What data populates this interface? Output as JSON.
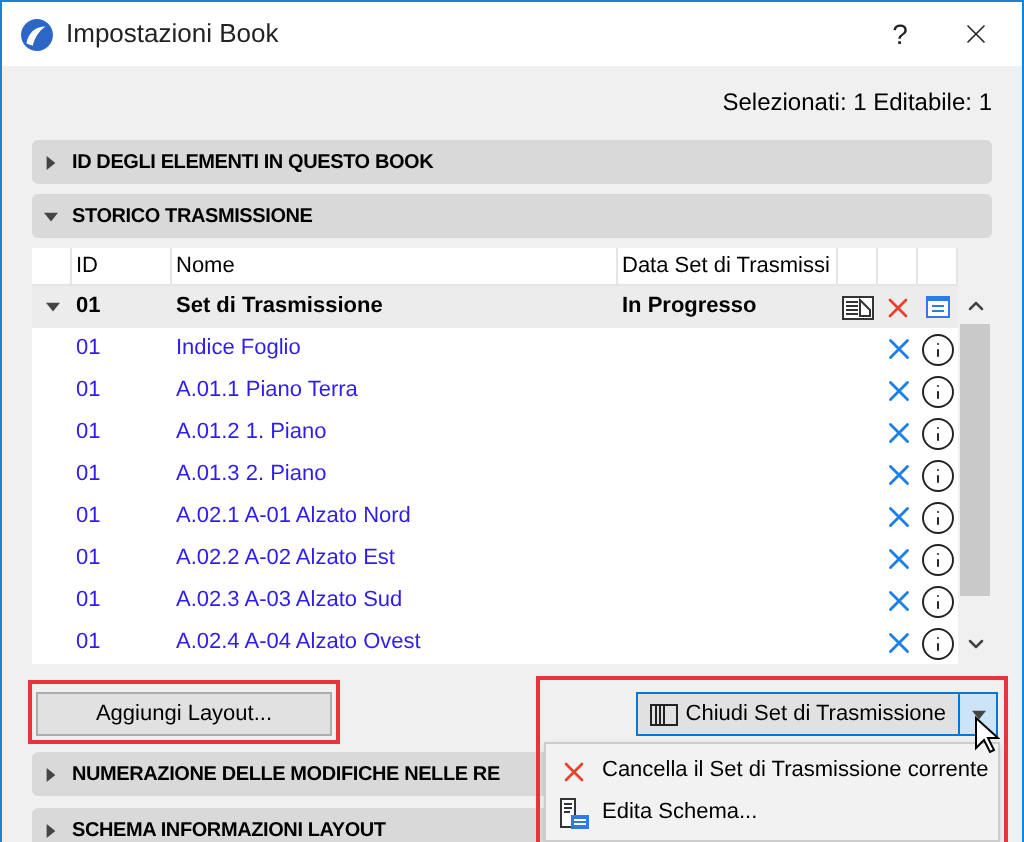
{
  "window": {
    "title": "Impostazioni Book",
    "help": "?"
  },
  "selection_info": "Selezionati: 1 Editabile: 1",
  "sections_top": [
    {
      "title": "ID DEGLI ELEMENTI IN QUESTO BOOK",
      "expanded": false
    },
    {
      "title": "STORICO TRASMISSIONE",
      "expanded": true
    }
  ],
  "table": {
    "columns": [
      "ID",
      "Nome",
      "Data Set di Trasmissi"
    ],
    "group": {
      "id": "01",
      "name": "Set di Trasmissione",
      "status": "In Progresso",
      "expanded": true
    },
    "rows": [
      {
        "id": "01",
        "name": "Indice Foglio"
      },
      {
        "id": "01",
        "name": "A.01.1 Piano Terra"
      },
      {
        "id": "01",
        "name": "A.01.2 1. Piano"
      },
      {
        "id": "01",
        "name": "A.01.3 2. Piano"
      },
      {
        "id": "01",
        "name": "A.02.1 A-01 Alzato Nord"
      },
      {
        "id": "01",
        "name": "A.02.2 A-02 Alzato Est"
      },
      {
        "id": "01",
        "name": "A.02.3 A-03 Alzato Sud"
      },
      {
        "id": "01",
        "name": "A.02.4 A-04 Alzato Ovest"
      }
    ]
  },
  "add_button": {
    "label": "Aggiungi Layout...",
    "highlighted": true
  },
  "split_button": {
    "label": "Chiudi Set di Trasmissione",
    "open": true,
    "highlighted": true
  },
  "menu": [
    {
      "kind": "delete",
      "label": "Cancella il Set di Trasmissione corrente"
    },
    {
      "kind": "schema",
      "label": "Edita Schema..."
    }
  ],
  "sections_bottom": [
    {
      "title": "NUMERAZIONE DELLE MODIFICHE NELLE RE",
      "expanded": false
    },
    {
      "title": "SCHEMA INFORMAZIONI LAYOUT",
      "expanded": false
    }
  ]
}
